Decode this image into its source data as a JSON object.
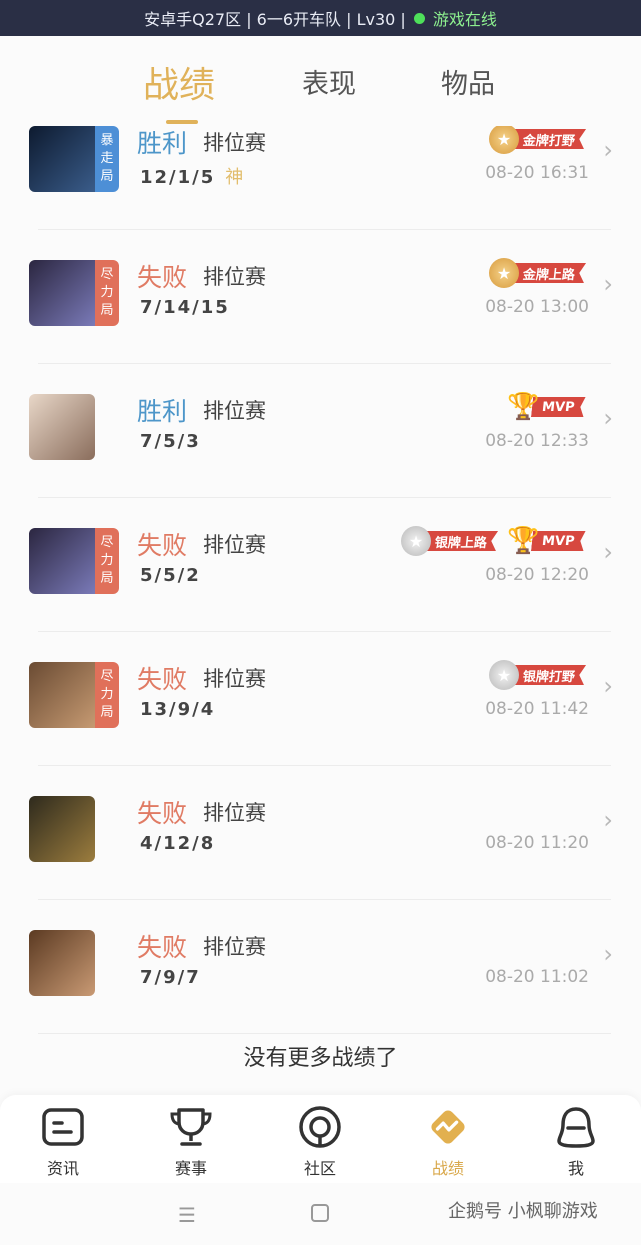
{
  "status_bar": {
    "text": "安卓手Q27区 | 6一6开车队 | Lv30 |",
    "online": "游戏在线"
  },
  "tabs": [
    {
      "label": "战绩",
      "active": true
    },
    {
      "label": "表现",
      "active": false
    },
    {
      "label": "物品",
      "active": false
    }
  ],
  "matches": [
    {
      "result": "胜利",
      "win": true,
      "mode": "排位赛",
      "kda": "12/1/5",
      "god": "神",
      "time": "08-20 16:31",
      "tag": [
        "暴",
        "走",
        "局"
      ],
      "tag_color": "blue",
      "badges": [
        {
          "type": "gold",
          "text": "金牌打野"
        }
      ]
    },
    {
      "result": "失败",
      "win": false,
      "mode": "排位赛",
      "kda": "7/14/15",
      "god": "",
      "time": "08-20 13:00",
      "tag": [
        "尽",
        "力",
        "局"
      ],
      "tag_color": "red",
      "badges": [
        {
          "type": "gold",
          "text": "金牌上路"
        }
      ]
    },
    {
      "result": "胜利",
      "win": true,
      "mode": "排位赛",
      "kda": "7/5/3",
      "god": "",
      "time": "08-20 12:33",
      "tag": [],
      "tag_color": "",
      "badges": [
        {
          "type": "mvp",
          "text": "MVP"
        }
      ]
    },
    {
      "result": "失败",
      "win": false,
      "mode": "排位赛",
      "kda": "5/5/2",
      "god": "",
      "time": "08-20 12:20",
      "tag": [
        "尽",
        "力",
        "局"
      ],
      "tag_color": "red",
      "badges": [
        {
          "type": "silver",
          "text": "银牌上路"
        },
        {
          "type": "mvp",
          "text": "MVP"
        }
      ]
    },
    {
      "result": "失败",
      "win": false,
      "mode": "排位赛",
      "kda": "13/9/4",
      "god": "",
      "time": "08-20 11:42",
      "tag": [
        "尽",
        "力",
        "局"
      ],
      "tag_color": "red",
      "badges": [
        {
          "type": "silver",
          "text": "银牌打野"
        }
      ]
    },
    {
      "result": "失败",
      "win": false,
      "mode": "排位赛",
      "kda": "4/12/8",
      "god": "",
      "time": "08-20 11:20",
      "tag": [],
      "tag_color": "",
      "badges": []
    },
    {
      "result": "失败",
      "win": false,
      "mode": "排位赛",
      "kda": "7/9/7",
      "god": "",
      "time": "08-20 11:02",
      "tag": [],
      "tag_color": "",
      "badges": []
    }
  ],
  "no_more": "没有更多战绩了",
  "bottom_nav": [
    {
      "label": "资讯",
      "icon": "news-icon",
      "active": false
    },
    {
      "label": "赛事",
      "icon": "trophy-icon",
      "active": false
    },
    {
      "label": "社区",
      "icon": "community-icon",
      "active": false
    },
    {
      "label": "战绩",
      "icon": "record-icon",
      "active": true
    },
    {
      "label": "我",
      "icon": "profile-icon",
      "active": false
    }
  ],
  "watermark": "企鹅号 小枫聊游戏",
  "colors": {
    "accent": "#e0b25a",
    "win": "#4d96c9",
    "lose": "#e07b64",
    "ribbon": "#d7483f"
  }
}
